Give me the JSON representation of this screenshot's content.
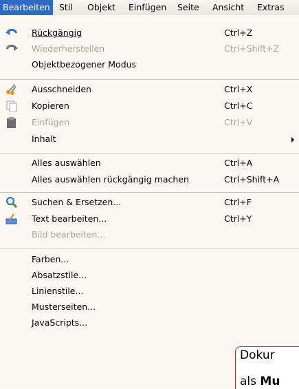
{
  "menubar": {
    "items": [
      {
        "label": "Bearbeiten"
      },
      {
        "label": "Stil"
      },
      {
        "label": "Objekt"
      },
      {
        "label": "Einfügen"
      },
      {
        "label": "Seite"
      },
      {
        "label": "Ansicht"
      },
      {
        "label": "Extras"
      }
    ]
  },
  "menu": {
    "undo": {
      "label": "Rückgängig",
      "shortcut": "Ctrl+Z"
    },
    "redo": {
      "label": "Wiederherstellen",
      "shortcut": "Ctrl+Shift+Z"
    },
    "object_mode": {
      "label": "Objektbezogener Modus"
    },
    "cut": {
      "label": "Ausschneiden",
      "shortcut": "Ctrl+X"
    },
    "copy": {
      "label": "Kopieren",
      "shortcut": "Ctrl+C"
    },
    "paste": {
      "label": "Einfügen",
      "shortcut": "Ctrl+V"
    },
    "content": {
      "label": "Inhalt"
    },
    "select_all": {
      "label": "Alles auswählen",
      "shortcut": "Ctrl+A"
    },
    "deselect_all": {
      "label": "Alles auswählen rückgängig machen",
      "shortcut": "Ctrl+Shift+A"
    },
    "find_replace": {
      "label": "Suchen & Ersetzen...",
      "shortcut": "Ctrl+F"
    },
    "edit_text": {
      "label": "Text bearbeiten...",
      "shortcut": "Ctrl+Y"
    },
    "edit_image": {
      "label": "Bild bearbeiten..."
    },
    "colors": {
      "label": "Farben..."
    },
    "paragraph_styles": {
      "label": "Absatzstile..."
    },
    "line_styles": {
      "label": "Linienstile..."
    },
    "master_pages": {
      "label": "Musterseiten..."
    },
    "javascripts": {
      "label": "JavaScripts..."
    }
  },
  "document": {
    "line1": "Dokur",
    "line2_prefix": "als ",
    "line2_bold": "Mu"
  },
  "colors": {
    "menubar_highlight": "#316ac5",
    "menu_bg": "#f9f8f3",
    "disabled_text": "#aaa59a",
    "doc_border": "#cc2a2a"
  }
}
